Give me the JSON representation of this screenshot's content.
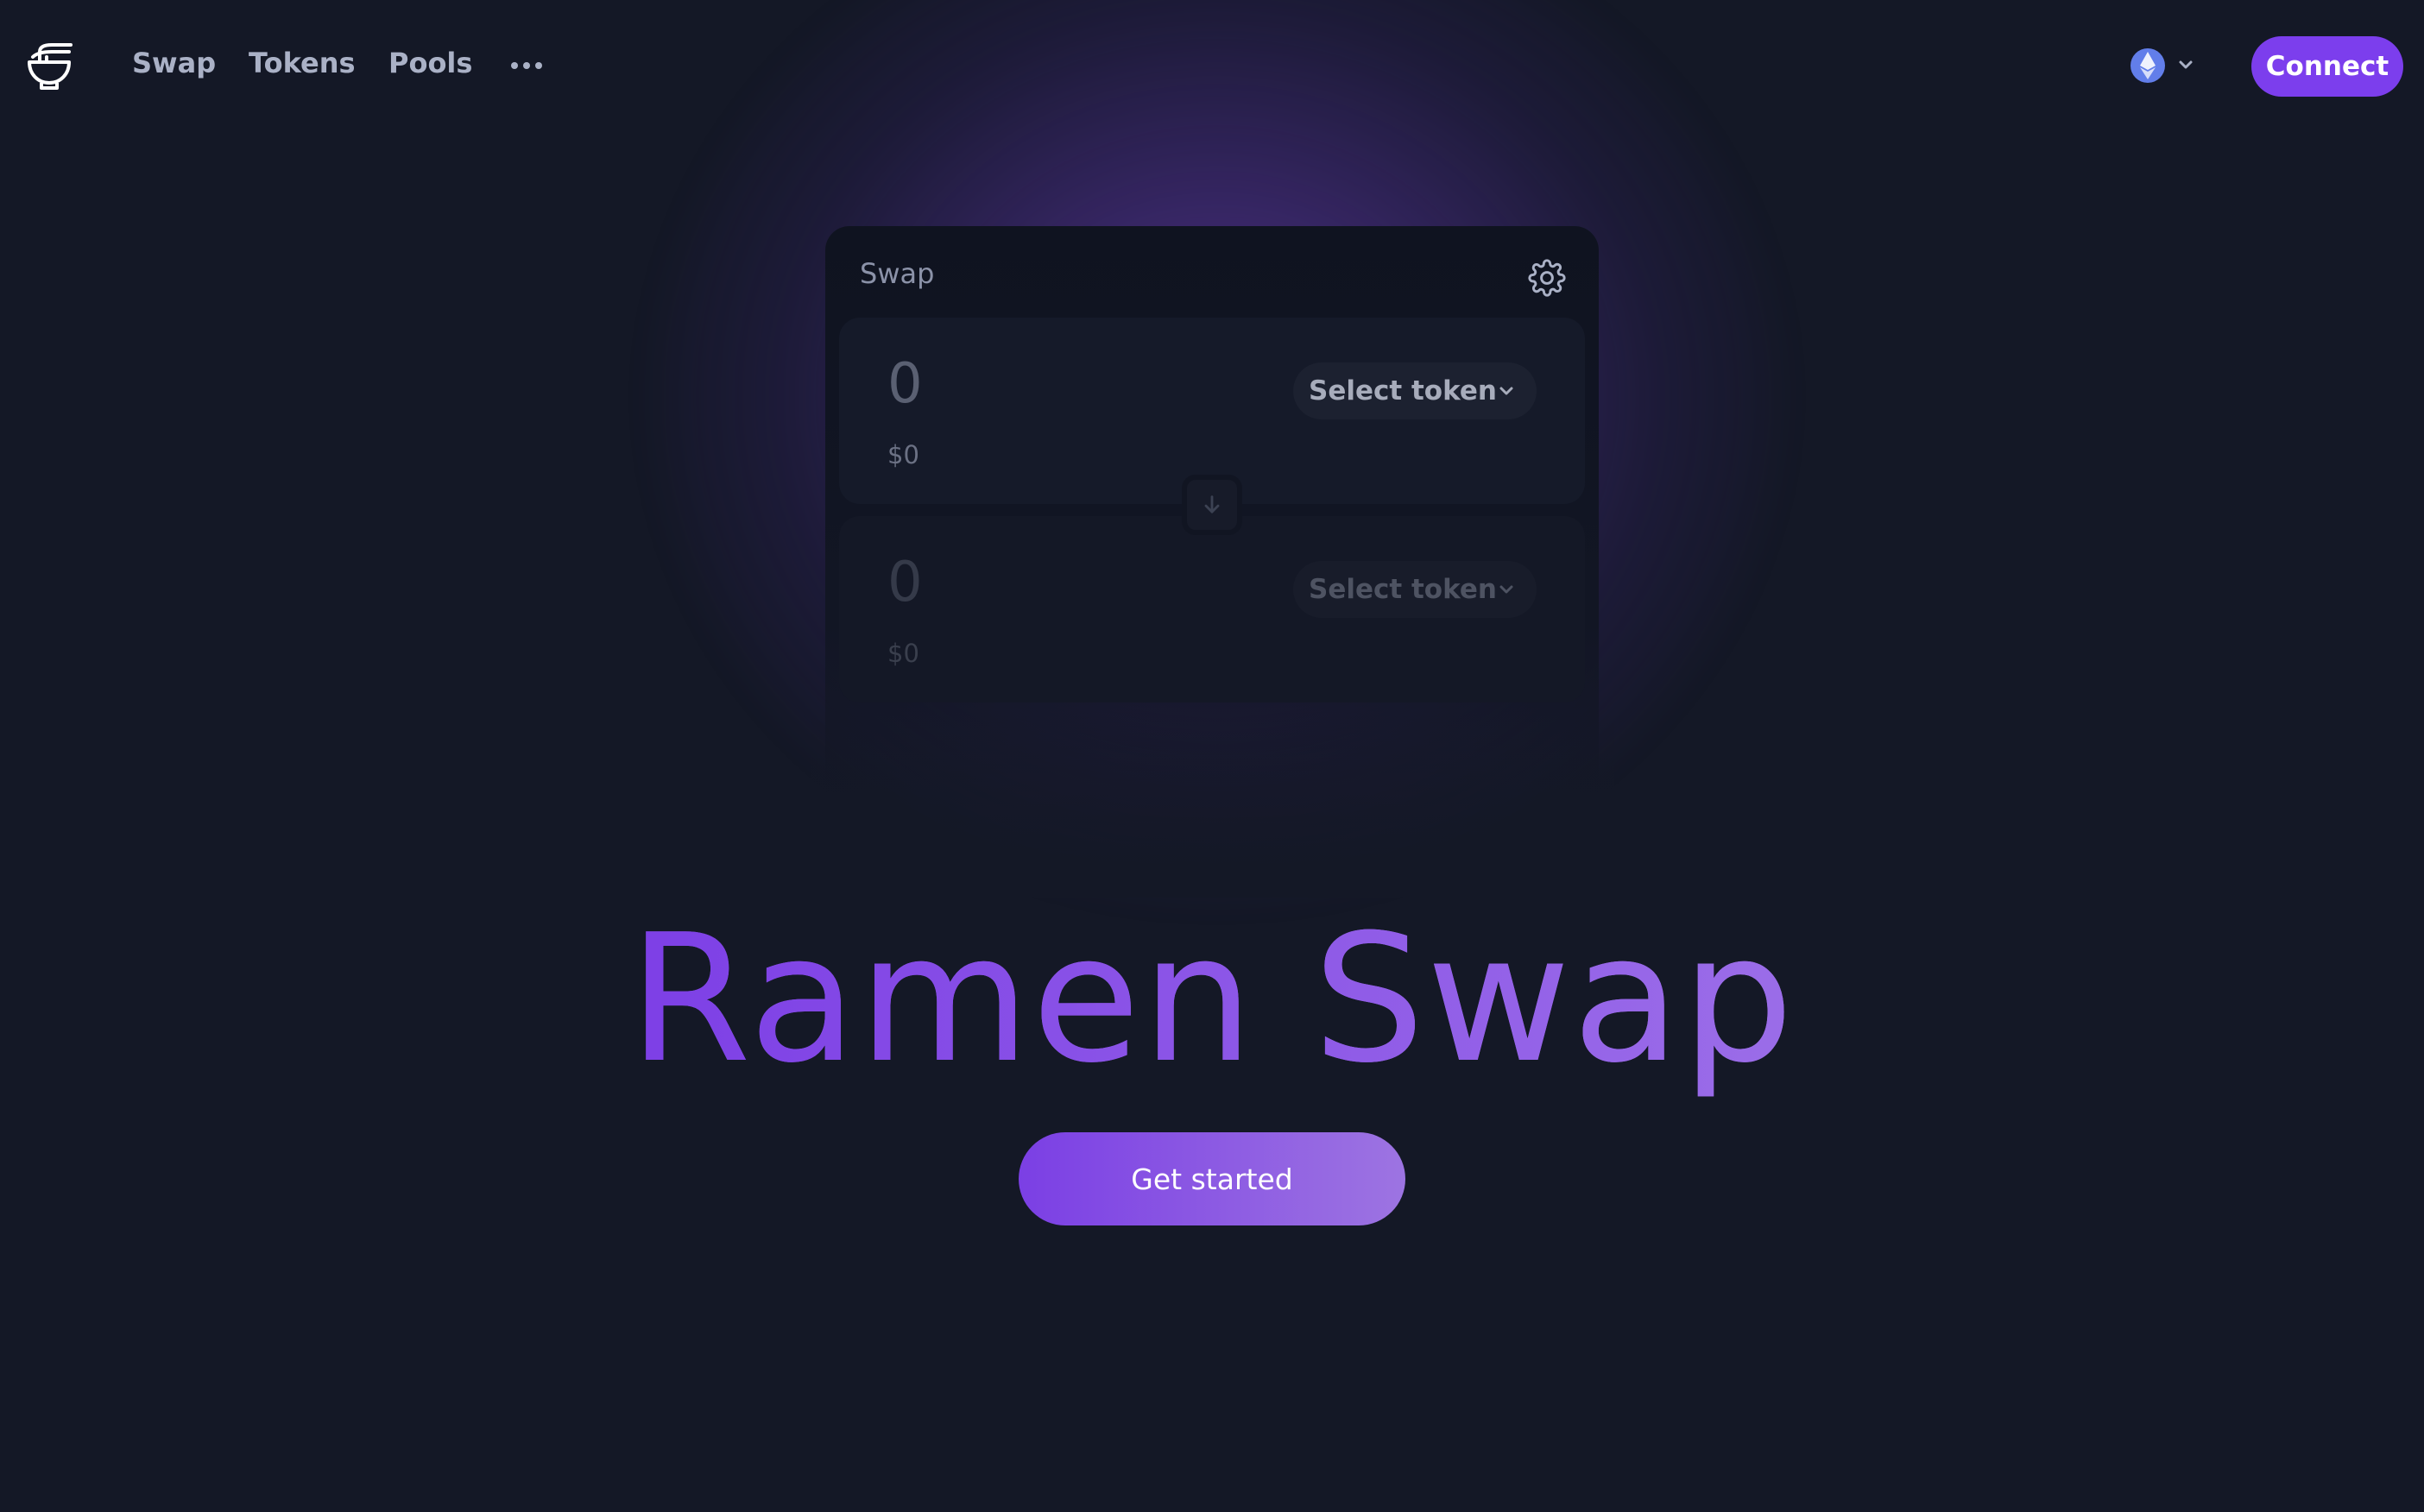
{
  "nav": {
    "logo_icon": "ramen-bowl-icon",
    "links": [
      {
        "label": "Swap"
      },
      {
        "label": "Tokens"
      },
      {
        "label": "Pools"
      }
    ],
    "more_icon": "more-horizontal-icon",
    "chain_icon": "ethereum-icon",
    "connect_label": "Connect"
  },
  "swap_card": {
    "title": "Swap",
    "settings_icon": "gear-icon",
    "input": {
      "amount_placeholder": "0",
      "usd_value": "$0",
      "token_button_label": "Select token"
    },
    "output": {
      "amount_placeholder": "0",
      "usd_value": "$0",
      "token_button_label": "Select token"
    },
    "switch_icon": "arrow-down-icon"
  },
  "hero": {
    "title": "Ramen Swap",
    "cta_label": "Get started"
  },
  "colors": {
    "background": "#141826",
    "accent": "#7c3eed",
    "hero_gradient_start": "#7d3fe6",
    "hero_gradient_end": "#a77de4"
  }
}
